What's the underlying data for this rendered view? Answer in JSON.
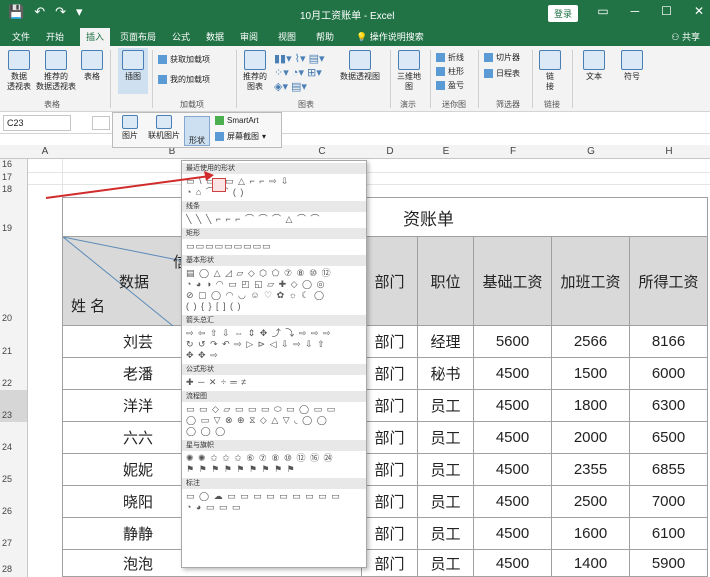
{
  "window": {
    "title": "10月工资账单 - Excel",
    "login": "登录",
    "quick_access": [
      "💾",
      "↶",
      "↷",
      "▾"
    ],
    "controls": [
      "▭",
      "─",
      "☐",
      "✕"
    ]
  },
  "tabs": [
    "文件",
    "开始",
    "插入",
    "页面布局",
    "公式",
    "数据",
    "审阅",
    "视图",
    "帮助",
    "操作说明搜索"
  ],
  "active_tab": "插入",
  "share": "共享",
  "ribbon": {
    "groups": [
      {
        "label": "表格",
        "buttons": [
          "数据\n透视表",
          "推荐的\n数据透视表",
          "表格"
        ]
      },
      {
        "label": "",
        "buttons": [
          "插图"
        ]
      },
      {
        "label": "加载项",
        "buttons": [
          "获取加载项",
          "我的加载项"
        ]
      },
      {
        "label": "图表",
        "buttons": [
          "推荐的\n图表",
          "数据透视图"
        ]
      },
      {
        "label": "演示",
        "buttons": [
          "三维地\n图"
        ]
      },
      {
        "label": "迷你图",
        "buttons": [
          "折线",
          "柱形",
          "盈亏"
        ]
      },
      {
        "label": "筛选器",
        "buttons": [
          "切片器",
          "日程表"
        ]
      },
      {
        "label": "链接",
        "buttons": [
          "链\n接"
        ]
      },
      {
        "label": "",
        "buttons": [
          "文本"
        ]
      },
      {
        "label": "",
        "buttons": [
          "符号"
        ]
      }
    ]
  },
  "illustrations_popup": {
    "items": [
      "图片",
      "联机图片",
      "形状"
    ],
    "smartart": "SmartArt",
    "screenshot": "屏幕截图"
  },
  "namebox": "C23",
  "columns": [
    "A",
    "B",
    "C",
    "D",
    "E",
    "F",
    "G",
    "H"
  ],
  "rows": [
    "16",
    "17",
    "18",
    "19",
    "20",
    "21",
    "22",
    "23",
    "24",
    "25",
    "26",
    "27",
    "28"
  ],
  "sheet": {
    "title_fragment": "资账单",
    "diag_header": {
      "top": "信",
      "mid": "数据",
      "bottom": "姓 名"
    },
    "headers": [
      "部门",
      "职位",
      "基础工资",
      "加班工资",
      "所得工资"
    ],
    "rows": [
      {
        "name": "刘芸",
        "dept": "部门",
        "pos": "经理",
        "base": "5600",
        "ot": "2566",
        "total": "8166"
      },
      {
        "name": "老潘",
        "dept": "部门",
        "pos": "秘书",
        "base": "4500",
        "ot": "1500",
        "total": "6000"
      },
      {
        "name": "洋洋",
        "dept": "部门",
        "pos": "员工",
        "base": "4500",
        "ot": "1800",
        "total": "6300"
      },
      {
        "name": "六六",
        "dept": "部门",
        "pos": "员工",
        "base": "4500",
        "ot": "2000",
        "total": "6500"
      },
      {
        "name": "妮妮",
        "dept": "部门",
        "pos": "员工",
        "base": "4500",
        "ot": "2355",
        "total": "6855"
      },
      {
        "name": "晓阳",
        "dept": "部门",
        "pos": "员工",
        "base": "4500",
        "ot": "2500",
        "total": "7000"
      },
      {
        "name": "静静",
        "dept": "部门",
        "pos": "员工",
        "base": "4500",
        "ot": "1600",
        "total": "6100"
      },
      {
        "name": "泡泡",
        "dept": "部门",
        "pos": "员工",
        "base": "4500",
        "ot": "1400",
        "total": "5900"
      }
    ]
  },
  "shapes_menu": {
    "sections": [
      {
        "label": "最近使用的形状",
        "rows": [
          "▭ \\ ▭▢▭ △ ⌐ ⌐ ⇨ ⇩",
          "◔ ⌂ ⌒ ⌒ ( )"
        ]
      },
      {
        "label": "线条",
        "rows": [
          "╲ ╲ ╲ ⌐ ⌐ ⌐ ⌒ ⌒ ⌒ △ ⌒ ⌒"
        ]
      },
      {
        "label": "矩形",
        "rows": [
          "▭▭▭▭▭▭▭▭▭"
        ]
      },
      {
        "label": "基本形状",
        "rows": [
          "▤ ◯ △ ◿ ▱ ◇ ⬡ ⬠ ⑦ ⑧ ⑩ ⑫",
          "◔ ◕ ◑ ◠ ▭ ◰ ◱ ▱ ✚ ◇ ◯ ◎",
          "⊘ ▢ ◯ ◠ ◡ ☺ ♡ ✿ ☼ ☾ ◯",
          "( ) { } [ ] ( )"
        ]
      },
      {
        "label": "箭头总汇",
        "rows": [
          "⇨ ⇦ ⇧ ⇩ ⇔ ⇕ ✥ ⤴ ⤵ ⇨ ⇨ ⇨",
          "↻ ↺ ↷ ↶ ⇨ ▷ ⊳ ◁ ⇩ ⇨ ⇩ ⇧",
          "✥ ✥ ⇨"
        ]
      },
      {
        "label": "公式形状",
        "rows": [
          "✚ ─ ✕ ÷ ═ ≠"
        ]
      },
      {
        "label": "流程图",
        "rows": [
          "▭ ▭ ◇ ▱ ▭ ▭ ▭ ⬭ ▭ ◯ ▭ ▭",
          "◯ ▭ ▽ ⊗ ⊕ ⧖ ◇ △ ▽ ◟ ◯ ◯",
          "◯ ◯ ◯"
        ]
      },
      {
        "label": "星与旗帜",
        "rows": [
          "✺ ✺ ✩ ✩ ✩ ⑥ ⑦ ⑧ ⑩ ⑫ ⑯ ㉔",
          "⚑ ⚑ ⚑ ⚑ ⚑ ⚑ ⚑ ⚑ ⚑"
        ]
      },
      {
        "label": "标注",
        "rows": [
          "▭ ◯ ☁ ▭ ▭ ▭ ▭ ▭ ▭ ▭ ▭ ▭",
          "◔ ◕ ▭ ▭ ▭"
        ]
      }
    ]
  },
  "accent": "#217346",
  "header_fill": "#d9d9d9",
  "arrow_color": "#d12c2c"
}
